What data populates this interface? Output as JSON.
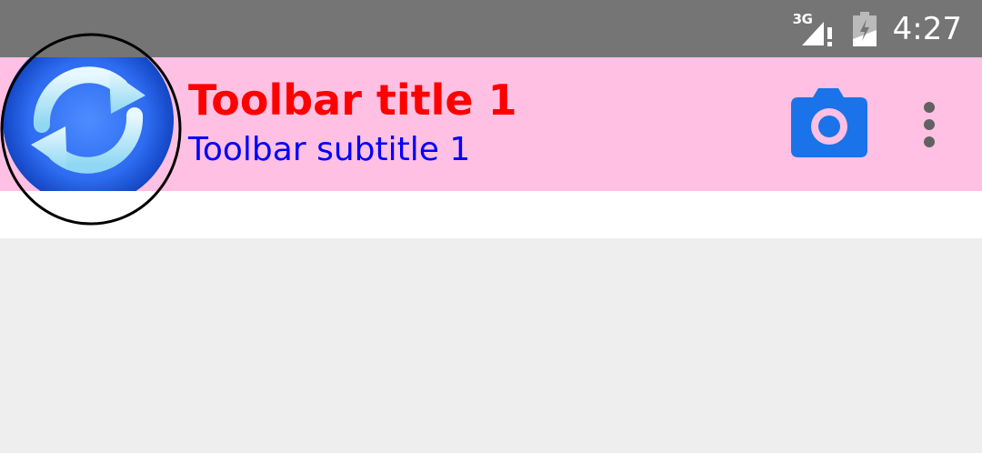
{
  "status_bar": {
    "network_type": "3G",
    "time": "4:27",
    "icons": [
      "signal-no-data-icon",
      "battery-charging-icon"
    ]
  },
  "toolbar": {
    "title": "Toolbar title 1",
    "subtitle": "Toolbar subtitle 1",
    "logo_icon": "sync-icon",
    "actions": [
      {
        "icon": "camera-icon"
      },
      {
        "icon": "more-vert-icon"
      }
    ],
    "colors": {
      "background": "#ffc0e3",
      "title": "#ff0000",
      "subtitle": "#0000ff",
      "camera": "#1a73e8",
      "status_bar": "#757575"
    }
  }
}
